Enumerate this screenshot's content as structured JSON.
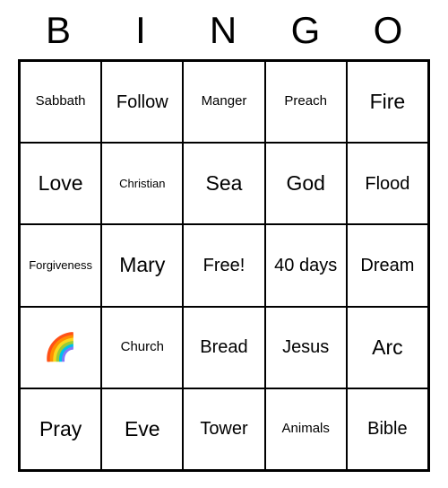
{
  "header": [
    "B",
    "I",
    "N",
    "G",
    "O"
  ],
  "grid": [
    [
      {
        "text": "Sabbath",
        "size": "small"
      },
      {
        "text": "Follow",
        "size": ""
      },
      {
        "text": "Manger",
        "size": "small"
      },
      {
        "text": "Preach",
        "size": "small"
      },
      {
        "text": "Fire",
        "size": "large"
      }
    ],
    [
      {
        "text": "Love",
        "size": "large"
      },
      {
        "text": "Christian",
        "size": "xsmall"
      },
      {
        "text": "Sea",
        "size": "large"
      },
      {
        "text": "God",
        "size": "large"
      },
      {
        "text": "Flood",
        "size": ""
      }
    ],
    [
      {
        "text": "Forgiveness",
        "size": "xsmall"
      },
      {
        "text": "Mary",
        "size": "large"
      },
      {
        "text": "Free!",
        "size": ""
      },
      {
        "text": "40 days",
        "size": ""
      },
      {
        "text": "Dream",
        "size": ""
      }
    ],
    [
      {
        "text": "🌈",
        "size": "rainbow"
      },
      {
        "text": "Church",
        "size": "small"
      },
      {
        "text": "Bread",
        "size": ""
      },
      {
        "text": "Jesus",
        "size": ""
      },
      {
        "text": "Arc",
        "size": "large"
      }
    ],
    [
      {
        "text": "Pray",
        "size": "large"
      },
      {
        "text": "Eve",
        "size": "large"
      },
      {
        "text": "Tower",
        "size": ""
      },
      {
        "text": "Animals",
        "size": "small"
      },
      {
        "text": "Bible",
        "size": ""
      }
    ]
  ]
}
